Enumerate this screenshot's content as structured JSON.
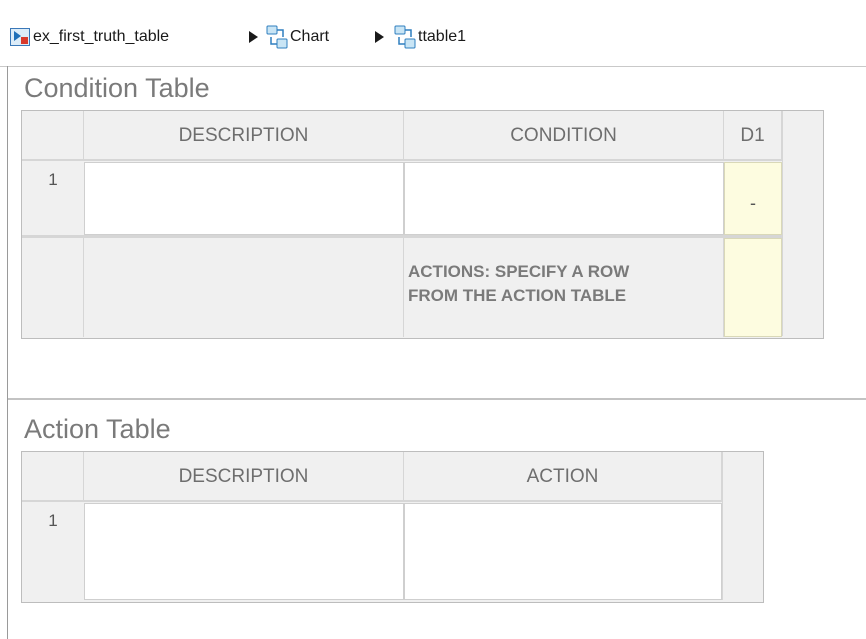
{
  "breadcrumb": {
    "items": [
      {
        "label": "ex_first_truth_table",
        "icon": "model-icon"
      },
      {
        "label": "Chart",
        "icon": "chart-icon"
      },
      {
        "label": "ttable1",
        "icon": "chart-icon"
      }
    ]
  },
  "condition_table": {
    "title": "Condition Table",
    "headers": [
      "DESCRIPTION",
      "CONDITION",
      "D1"
    ],
    "rows": [
      {
        "number": "1",
        "description": "",
        "condition": "",
        "decision": "-"
      }
    ],
    "actions_label_line1": "ACTIONS: SPECIFY A ROW",
    "actions_label_line2": "FROM THE ACTION TABLE"
  },
  "action_table": {
    "title": "Action Table",
    "headers": [
      "DESCRIPTION",
      "ACTION"
    ],
    "rows": [
      {
        "number": "1",
        "description": "",
        "action": ""
      }
    ]
  },
  "colors": {
    "decision_cell": "#fdfce0",
    "header_bg": "#f0f0f0",
    "title_text": "#7a7a7a"
  }
}
